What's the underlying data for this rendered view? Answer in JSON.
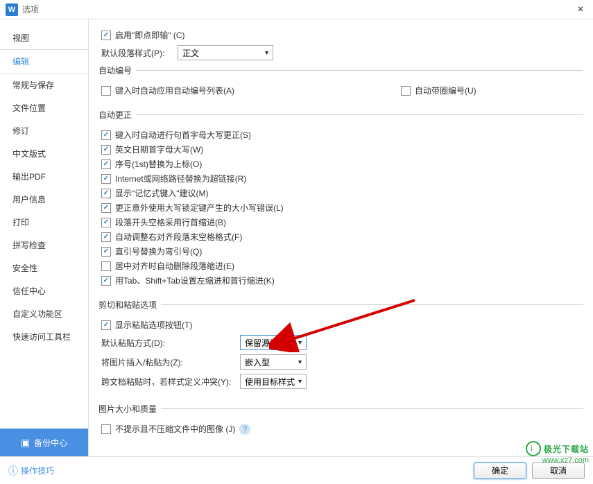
{
  "titlebar": {
    "title": "选项"
  },
  "sidebar": {
    "items": [
      "视图",
      "编辑",
      "常规与保存",
      "文件位置",
      "修订",
      "中文版式",
      "输出PDF",
      "用户信息",
      "打印",
      "拼写检查",
      "安全性",
      "信任中心",
      "自定义功能区",
      "快速访问工具栏"
    ],
    "backup": "备份中心"
  },
  "content": {
    "click_type": "启用\"即点即输\" (C)",
    "default_para_label": "默认段落样式(P):",
    "default_para_value": "正文",
    "group_autonumber": "自动编号",
    "autonumber_apply": "键入时自动应用自动编号列表(A)",
    "autonumber_circle": "自动带圈编号(U)",
    "group_autocorrect": "自动更正",
    "ac1": "键入时自动进行句首字母大写更正(S)",
    "ac2": "英文日期首字母大写(W)",
    "ac3": "序号(1st)替换为上标(O)",
    "ac4": "Internet或网络路径替换为超链接(R)",
    "ac5": "显示\"记忆式键入\"建议(M)",
    "ac6": "更正意外使用大写锁定键产生的大小写错误(L)",
    "ac7": "段落开头空格采用行首缩进(B)",
    "ac8": "自动调整右对齐段落末空格格式(F)",
    "ac9": "直引号替换为弯引号(Q)",
    "ac10": "居中对齐时自动删除段落缩进(E)",
    "ac11": "用Tab、Shift+Tab设置左缩进和首行缩进(K)",
    "group_cutpaste": "剪切和粘贴选项",
    "cp_show": "显示粘贴选项按钮(T)",
    "cp_default_label": "默认粘贴方式(D):",
    "cp_default_value": "保留源格式",
    "cp_image_label": "将图片插入/粘贴为(Z):",
    "cp_image_value": "嵌入型",
    "cp_cross_label": "跨文档粘贴时，若样式定义冲突(Y):",
    "cp_cross_value": "使用目标样式",
    "group_image": "图片大小和质量",
    "img_nocompress": "不提示且不压缩文件中的图像 (J)"
  },
  "footer": {
    "tips": "操作技巧",
    "ok": "确定",
    "cancel": "取消"
  },
  "watermark": {
    "l1": "极光下载站",
    "l2": "www.xz7.com"
  }
}
